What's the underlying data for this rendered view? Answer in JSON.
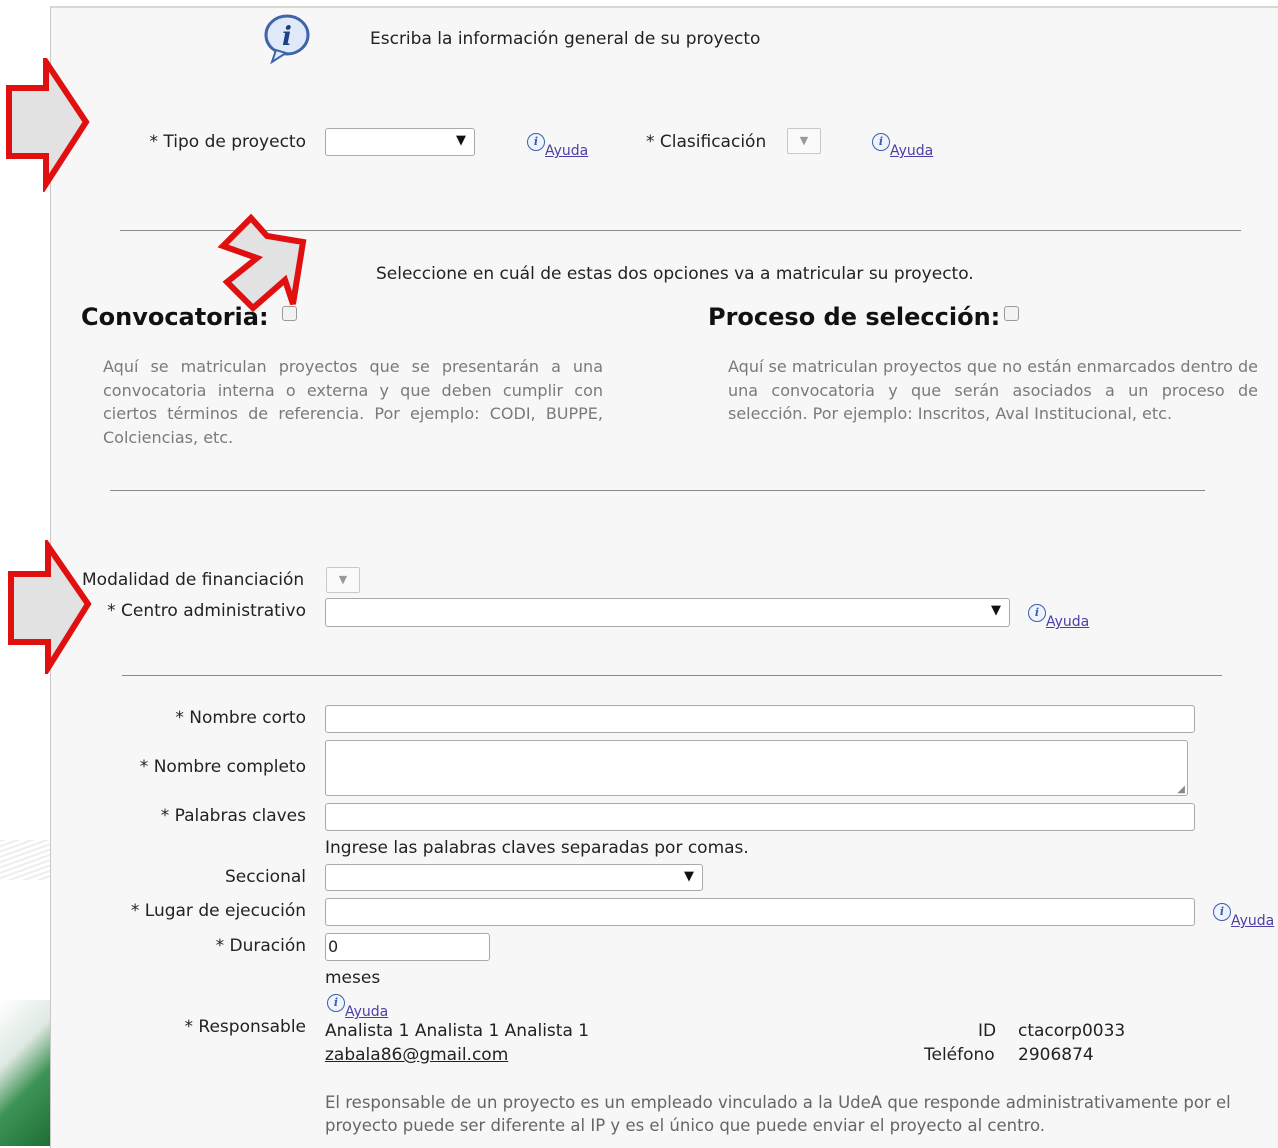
{
  "intro": {
    "text": "Escriba la información general de su proyecto",
    "info_icon": "info-icon"
  },
  "tipo": {
    "label": "* Tipo de proyecto",
    "value": ""
  },
  "clasificacion": {
    "label": "* Clasificación"
  },
  "help_label": "Ayuda",
  "opciones": {
    "instruction": "Seleccione en cuál de estas dos opciones va a matricular su proyecto.",
    "convocatoria": {
      "title": "Convocatoria:",
      "desc": "Aquí se matriculan proyectos que se presentarán a una convocatoria interna o externa y que deben cumplir con ciertos términos de referencia. Por ejemplo: CODI, BUPPE, Colciencias, etc.",
      "checked": false
    },
    "proceso": {
      "title": "Proceso de selección:",
      "desc": "Aquí se matriculan proyectos que no están enmarcados dentro de una convocatoria y que serán asociados a un proceso de selección. Por ejemplo: Inscritos, Aval Institucional, etc.",
      "checked": false
    }
  },
  "modalidad": {
    "label": "Modalidad de financiación"
  },
  "centro": {
    "label": "* Centro administrativo",
    "value": ""
  },
  "form": {
    "nombre_corto": {
      "label": "* Nombre corto",
      "value": ""
    },
    "nombre_completo": {
      "label": "* Nombre completo",
      "value": ""
    },
    "palabras": {
      "label": "* Palabras claves",
      "value": "",
      "hint": "Ingrese las palabras claves separadas por comas."
    },
    "seccional": {
      "label": "Seccional",
      "value": ""
    },
    "lugar": {
      "label": "* Lugar de ejecución",
      "value": ""
    },
    "duracion": {
      "label": "* Duración",
      "value": "0",
      "unit": "meses"
    },
    "responsable": {
      "label": "* Responsable",
      "name": "Analista 1 Analista 1 Analista 1",
      "email": "zabala86@gmail.com",
      "id_label": "ID",
      "id_value": "ctacorp0033",
      "tel_label": "Teléfono",
      "tel_value": "2906874",
      "note_line1": "El responsable de un proyecto es un empleado vinculado a la UdeA que responde administrativamente por el",
      "note_line2": "proyecto puede ser diferente al IP y es el único que puede enviar el proyecto al centro."
    }
  },
  "colors": {
    "arrow_red": "#e01010",
    "arrow_fill": "#e2e2e2",
    "link": "#4b3ea8"
  }
}
